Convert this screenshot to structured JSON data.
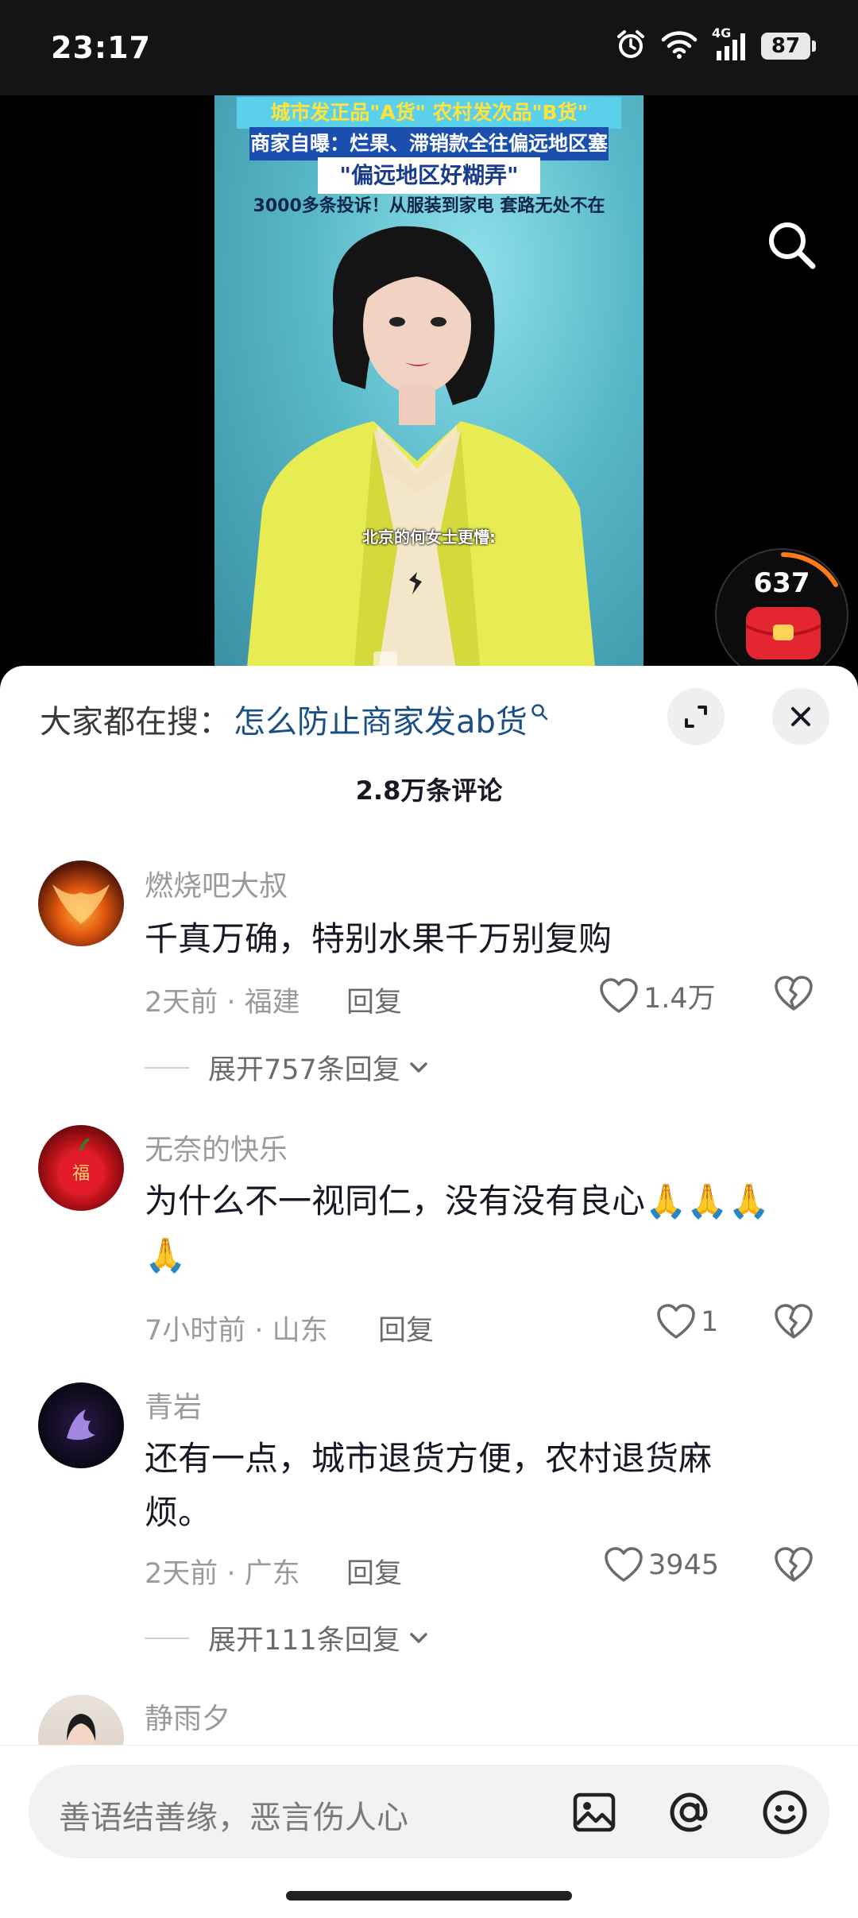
{
  "status_bar": {
    "time": "23:17",
    "network": "4G",
    "battery": "87"
  },
  "video": {
    "headline_1": "城市发正品\"A货\" 农村发次品\"B货\"",
    "headline_2": "商家自曝：烂果、滞销款全往偏远地区塞",
    "headline_3": "\"偏远地区好糊弄\"",
    "headline_4": "3000多条投诉！从服装到家电 套路无处不在",
    "subtitle": "北京的何女士更懵:"
  },
  "red_packet": {
    "count": "637"
  },
  "comment_panel": {
    "search_prefix": "大家都在搜：",
    "search_query": "怎么防止商家发ab货",
    "comment_count": "2.8万条评论",
    "comments": [
      {
        "user": "燃烧吧大叔",
        "text": "千真万确，特别水果千万别复购",
        "meta": "2天前 · 福建",
        "reply": "回复",
        "likes": "1.4万",
        "expand": "展开757条回复"
      },
      {
        "user": "无奈的快乐",
        "text": "为什么不一视同仁，没有没有良心🙏🙏🙏🙏",
        "meta": "7小时前 · 山东",
        "reply": "回复",
        "likes": "1"
      },
      {
        "user": "青岩",
        "text": "还有一点，城市退货方便，农村退货麻烦。",
        "meta": "2天前 · 广东",
        "reply": "回复",
        "likes": "3945",
        "expand": "展开111条回复"
      },
      {
        "user": "静雨夕"
      }
    ]
  },
  "input": {
    "placeholder": "善语结善缘，恶言伤人心"
  },
  "icons": [
    "search-icon",
    "expand-icon",
    "close-icon",
    "heart-icon",
    "broken-heart-icon",
    "chevron-down-icon",
    "image-icon",
    "at-icon",
    "emoji-icon",
    "red-packet-icon",
    "alarm-icon",
    "wifi-icon",
    "signal-icon"
  ],
  "colors": {
    "accent_query": "#1a4f86",
    "red_packet": "#e3262f",
    "video_bg": "#58b8c8",
    "jacket": "#e6ec52"
  }
}
